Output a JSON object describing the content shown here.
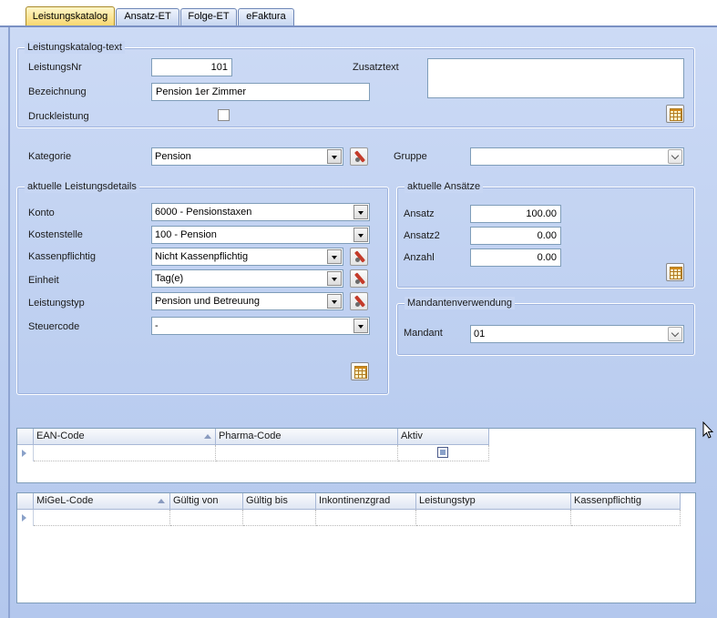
{
  "tabs": [
    {
      "label": "Leistungskatalog",
      "active": true
    },
    {
      "label": "Ansatz-ET",
      "active": false
    },
    {
      "label": "Folge-ET",
      "active": false
    },
    {
      "label": "eFaktura",
      "active": false
    }
  ],
  "katalog_group": {
    "title": "Leistungskatalog-text",
    "leistungsnr_label": "LeistungsNr",
    "leistungsnr_value": "101",
    "bezeichnung_label": "Bezeichnung",
    "bezeichnung_value": "Pension 1er Zimmer",
    "druckleistung_label": "Druckleistung",
    "druckleistung_checked": false,
    "zusatztext_label": "Zusatztext",
    "zusatztext_value": ""
  },
  "kategorie": {
    "label": "Kategorie",
    "value": "Pension"
  },
  "gruppe": {
    "label": "Gruppe",
    "value": ""
  },
  "details_group": {
    "title": "aktuelle Leistungsdetails",
    "konto": {
      "label": "Konto",
      "value": "6000 - Pensionstaxen"
    },
    "kostenstelle": {
      "label": "Kostenstelle",
      "value": "100 - Pension"
    },
    "kassenpflichtig": {
      "label": "Kassenpflichtig",
      "value": "Nicht Kassenpflichtig"
    },
    "einheit": {
      "label": "Einheit",
      "value": "Tag(e)"
    },
    "leistungstyp": {
      "label": "Leistungstyp",
      "value": "Pension und Betreuung"
    },
    "steuercode": {
      "label": "Steuercode",
      "value": "-"
    }
  },
  "ansaetze_group": {
    "title": "aktuelle Ansätze",
    "ansatz": {
      "label": "Ansatz",
      "value": "100.00"
    },
    "ansatz2": {
      "label": "Ansatz2",
      "value": "0.00"
    },
    "anzahl": {
      "label": "Anzahl",
      "value": "0.00"
    }
  },
  "mandanten_group": {
    "title": "Mandantenverwendung",
    "mandant": {
      "label": "Mandant",
      "value": "01"
    }
  },
  "ean_grid": {
    "columns": [
      "EAN-Code",
      "Pharma-Code",
      "Aktiv"
    ]
  },
  "migel_grid": {
    "columns": [
      "MiGeL-Code",
      "Gültig von",
      "Gültig bis",
      "Inkontinenzgrad",
      "Leistungstyp",
      "Kassenpflichtig"
    ]
  },
  "icons": [
    "edit-icon",
    "grid-picker-icon",
    "dropdown-arrow-icon",
    "sort-ascending-icon",
    "row-indicator-icon",
    "mouse-pointer-icon"
  ]
}
